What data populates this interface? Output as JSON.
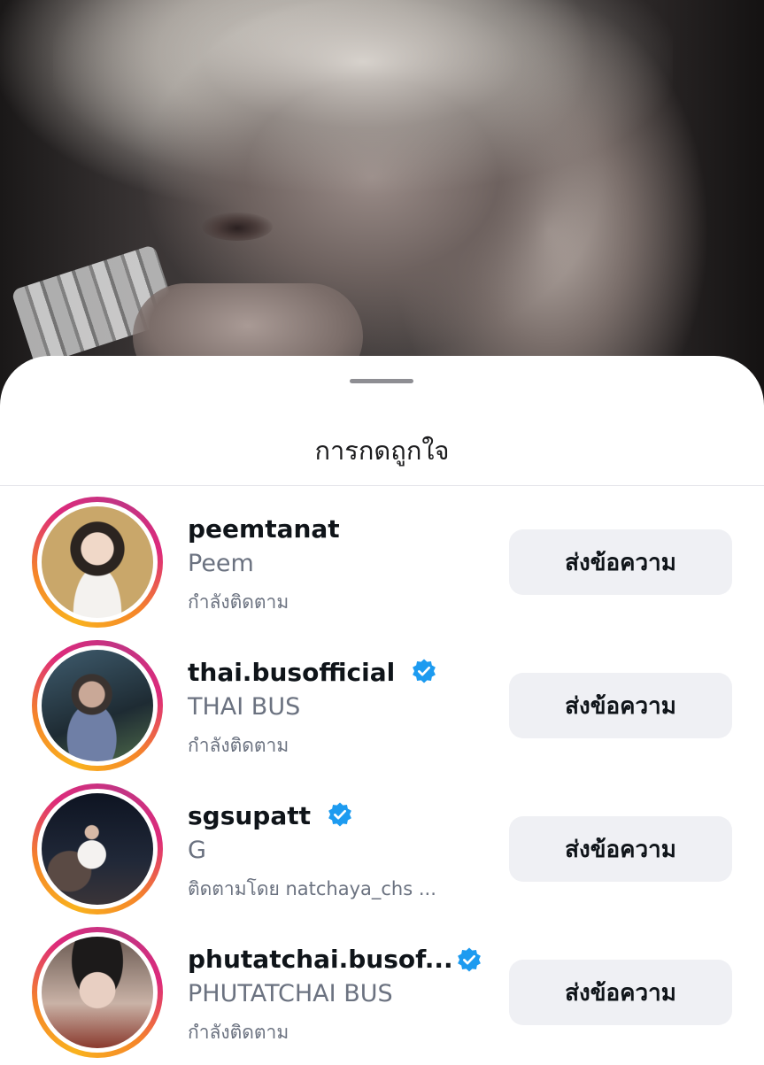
{
  "sheet": {
    "title": "การกดถูกใจ"
  },
  "likes": [
    {
      "username": "peemtanat",
      "full_name": "Peem",
      "status": "กำลังติดตาม",
      "verified": false,
      "button_label": "ส่งข้อความ"
    },
    {
      "username": "thai.busofficial",
      "full_name": "THAI BUS",
      "status": "กำลังติดตาม",
      "verified": true,
      "button_label": "ส่งข้อความ"
    },
    {
      "username": "sgsupatt",
      "full_name": "G",
      "status": "ติดตามโดย natchaya_chs ...",
      "verified": true,
      "button_label": "ส่งข้อความ"
    },
    {
      "username": "phutatchai.busof...",
      "full_name": "PHUTATCHAI BUS",
      "status": "กำลังติดตาม",
      "verified": true,
      "button_label": "ส่งข้อความ"
    }
  ],
  "colors": {
    "verified_badge": "#1d9bf0",
    "button_bg": "#eff0f4",
    "ring_gradient": [
      "#f9b21e",
      "#dd2a7b",
      "#c13584"
    ]
  }
}
